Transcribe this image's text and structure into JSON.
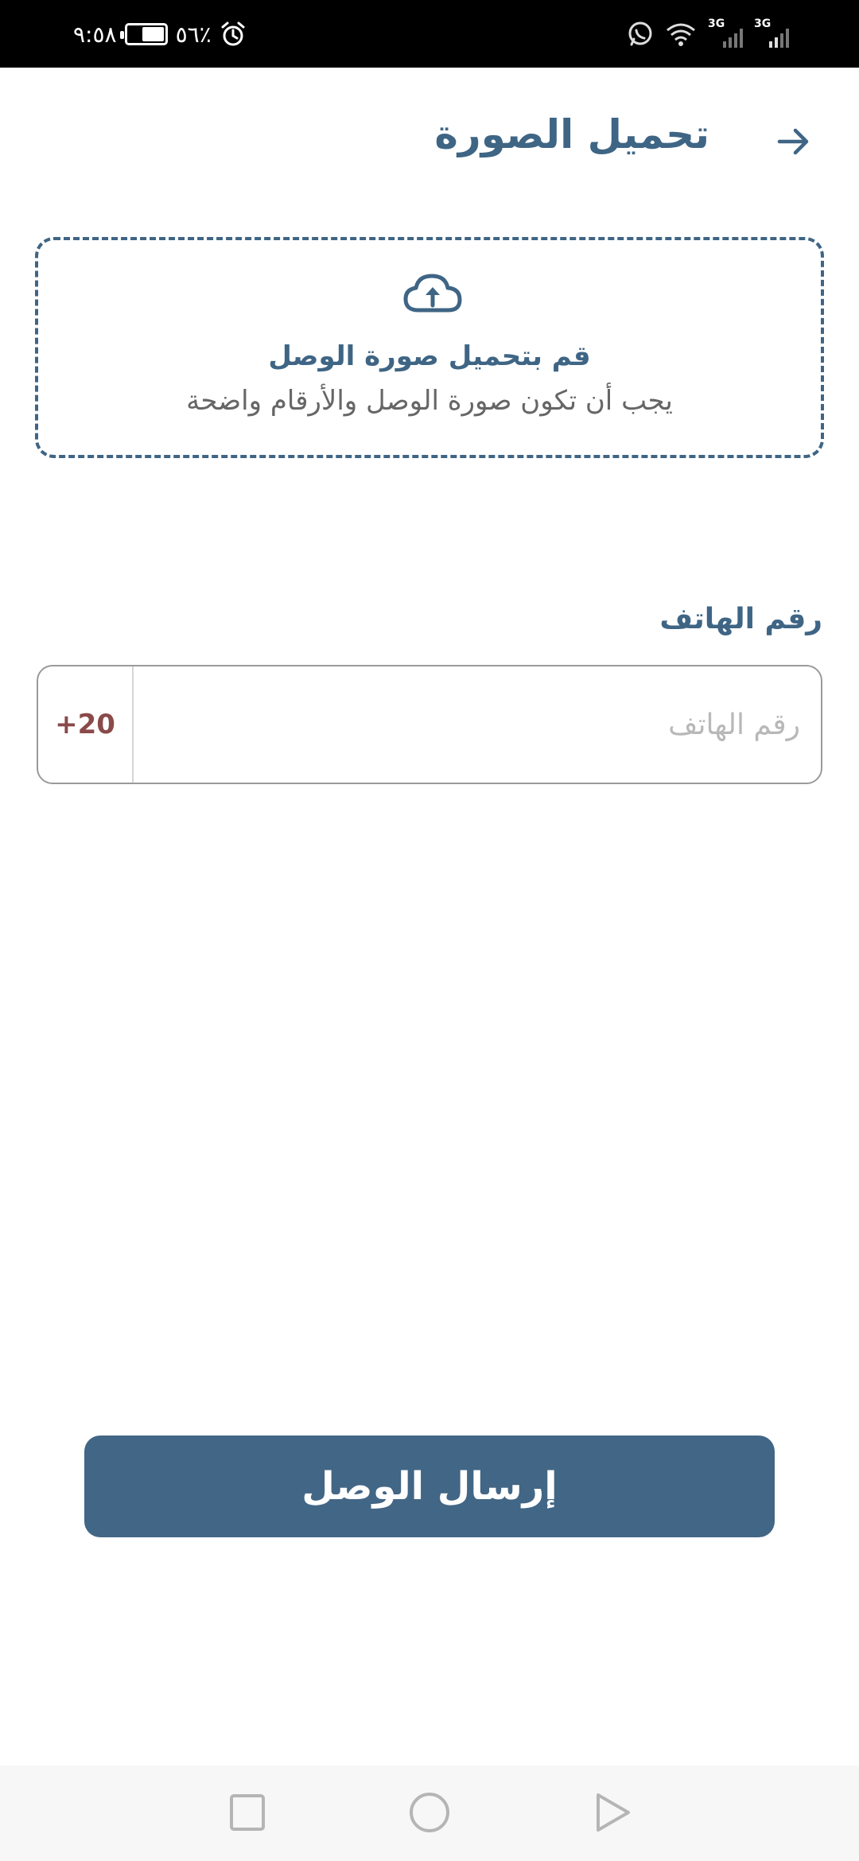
{
  "status_bar": {
    "time": "٩:٥٨",
    "battery_percent": "٥٦٪",
    "battery_level": 0.56,
    "network_labels": [
      "3G",
      "3G"
    ]
  },
  "header": {
    "title": "تحميل الصورة",
    "back_icon": "arrow-right-icon"
  },
  "upload": {
    "icon": "cloud-upload-icon",
    "title": "قم بتحميل صورة الوصل",
    "subtitle": "يجب أن تكون صورة الوصل والأرقام واضحة"
  },
  "phone": {
    "label": "رقم الهاتف",
    "country_code": "+20",
    "placeholder": "رقم الهاتف",
    "value": ""
  },
  "submit": {
    "label": "إرسال الوصل"
  },
  "colors": {
    "primary": "#3f6585",
    "button": "#426685",
    "country_code": "#8a4a4a",
    "subtitle": "#666666",
    "status_bar": "#000000"
  },
  "nav": {
    "icons": [
      "recent-apps-icon",
      "home-icon",
      "back-icon"
    ]
  }
}
